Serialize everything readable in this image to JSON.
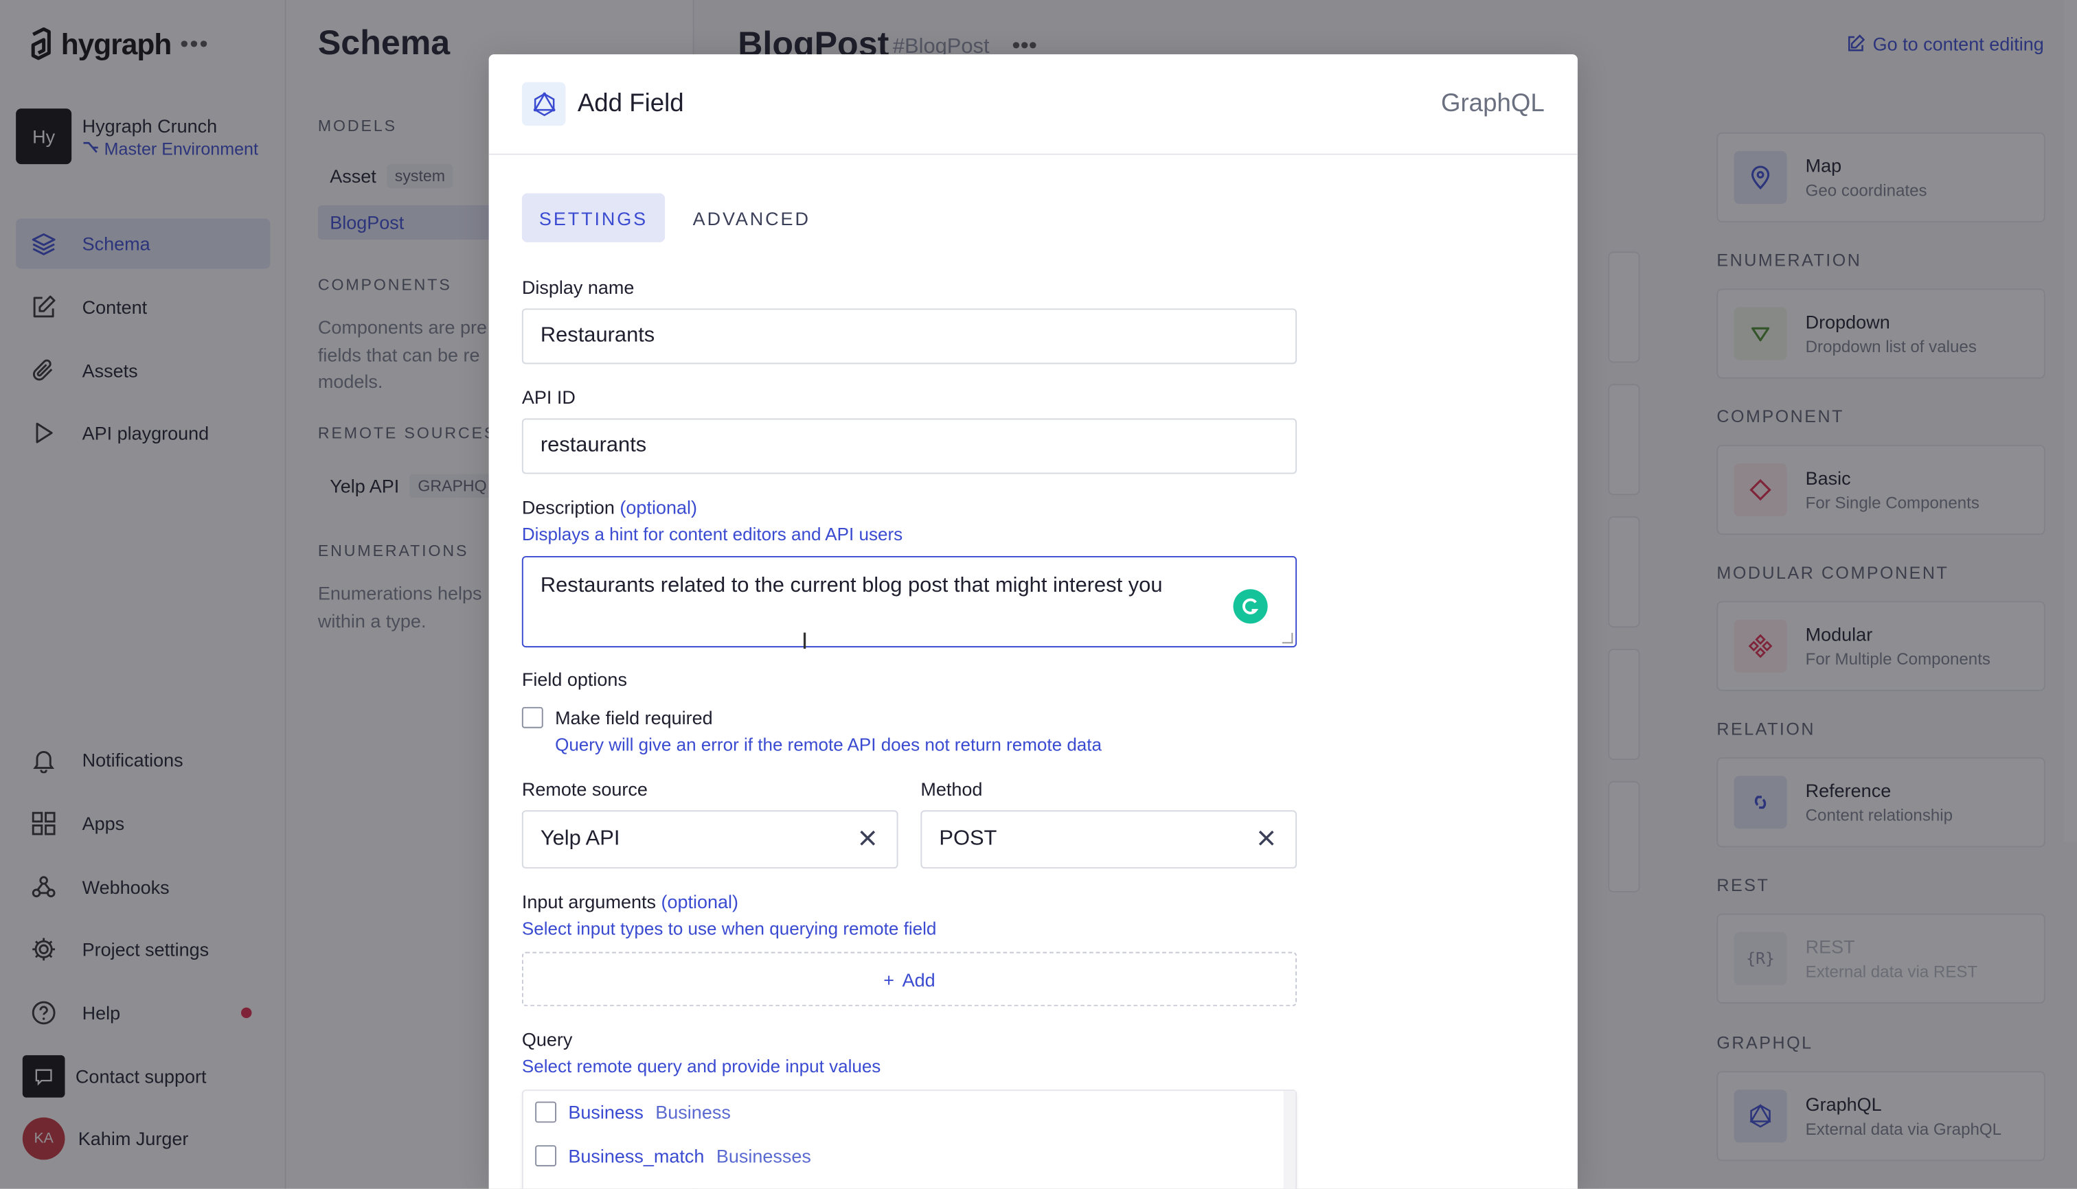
{
  "sidebar": {
    "logo_text": "hygraph",
    "project": {
      "initials": "Hy",
      "name": "Hygraph Crunch",
      "environment": "Master Environment"
    },
    "nav_top": [
      {
        "label": "Schema",
        "icon": "layers-icon",
        "active": true
      },
      {
        "label": "Content",
        "icon": "edit-icon"
      },
      {
        "label": "Assets",
        "icon": "paperclip-icon"
      },
      {
        "label": "API playground",
        "icon": "play-icon"
      }
    ],
    "nav_bottom": [
      {
        "label": "Notifications",
        "icon": "bell-icon"
      },
      {
        "label": "Apps",
        "icon": "apps-icon"
      },
      {
        "label": "Webhooks",
        "icon": "webhook-icon"
      },
      {
        "label": "Project settings",
        "icon": "gear-icon"
      },
      {
        "label": "Help",
        "icon": "help-icon"
      },
      {
        "label": "Contact support",
        "icon": "chat-icon"
      }
    ],
    "user": {
      "initials": "KA",
      "name": "Kahim Jurger"
    }
  },
  "schema": {
    "title": "Schema",
    "models_label": "MODELS",
    "models": [
      {
        "name": "Asset",
        "tag": "system"
      },
      {
        "name": "BlogPost"
      }
    ],
    "components_label": "COMPONENTS",
    "components_desc": "Components are pre fields that can be re models.",
    "remote_label": "REMOTE SOURCES",
    "remote_item": {
      "name": "Yelp API",
      "tag": "GRAPHQ"
    },
    "enum_label": "ENUMERATIONS",
    "enum_desc": "Enumerations helps within a type."
  },
  "main": {
    "title": "BlogPost",
    "api_id": "#BlogPost",
    "goto_label": "Go to content editing"
  },
  "right_panel": {
    "map": {
      "name": "Map",
      "desc": "Geo coordinates"
    },
    "sections": [
      {
        "label": "ENUMERATION",
        "card": {
          "name": "Dropdown",
          "desc": "Dropdown list of values",
          "icon": "dropdown-icon",
          "color": "#4b8a2e"
        }
      },
      {
        "label": "COMPONENT",
        "card": {
          "name": "Basic",
          "desc": "For Single Components",
          "icon": "diamond-icon",
          "color": "#e0294a"
        }
      },
      {
        "label": "MODULAR COMPONENT",
        "card": {
          "name": "Modular",
          "desc": "For Multiple Components",
          "icon": "modular-icon",
          "color": "#e0294a"
        }
      },
      {
        "label": "RELATION",
        "card": {
          "name": "Reference",
          "desc": "Content relationship",
          "icon": "link-icon",
          "color": "#3a4bd1"
        }
      },
      {
        "label": "REST",
        "card": {
          "name": "REST",
          "desc": "External data via REST",
          "icon": "rest-icon",
          "color": "#8a8fa0"
        }
      },
      {
        "label": "GRAPHQL",
        "card": {
          "name": "GraphQL",
          "desc": "External data via GraphQL",
          "icon": "graphql-icon",
          "color": "#3a4bd1"
        }
      }
    ]
  },
  "modal": {
    "title": "Add Field",
    "type_label": "GraphQL",
    "tabs": [
      "SETTINGS",
      "ADVANCED"
    ],
    "display_name_label": "Display name",
    "display_name_value": "Restaurants",
    "api_id_label": "API ID",
    "api_id_value": "restaurants",
    "description_label": "Description",
    "optional": "(optional)",
    "description_hint": "Displays a hint for content editors and API users",
    "description_value": "Restaurants related to the current blog post that might interest you",
    "field_options_label": "Field options",
    "required_label": "Make field required",
    "required_hint": "Query will give an error if the remote API does not return remote data",
    "remote_source_label": "Remote source",
    "remote_source_value": "Yelp API",
    "method_label": "Method",
    "method_value": "POST",
    "input_args_label": "Input arguments",
    "input_args_hint": "Select input types to use when querying remote field",
    "add_label": "Add",
    "query_label": "Query",
    "query_hint": "Select remote query and provide input values",
    "query_items": [
      {
        "name": "Business",
        "type": "Business"
      },
      {
        "name": "Business_match",
        "type": "Businesses"
      }
    ]
  }
}
